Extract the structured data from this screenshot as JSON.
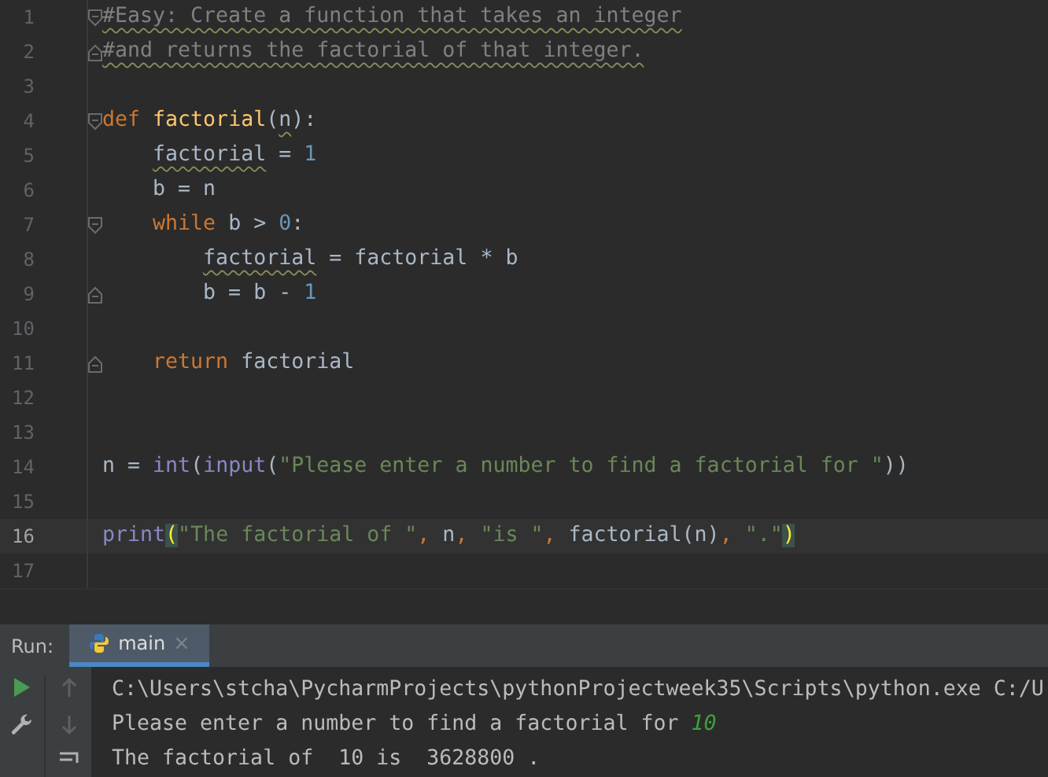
{
  "editor": {
    "lines": [
      {
        "number": "1",
        "current": false,
        "fold_start": true,
        "fold_end": false,
        "tokens": [
          {
            "text": "#Easy: Create a function that takes an integer",
            "kind": "comment",
            "squiggle": true
          }
        ]
      },
      {
        "number": "2",
        "current": false,
        "fold_start": false,
        "fold_end": true,
        "tokens": [
          {
            "text": "#and returns the factorial of that integer.",
            "kind": "comment",
            "squiggle": true
          }
        ]
      },
      {
        "number": "3",
        "current": false,
        "fold_start": false,
        "fold_end": false
      },
      {
        "number": "4",
        "current": false,
        "fold_start": true,
        "fold_end": false,
        "tokens": [
          {
            "text": "def ",
            "kind": "keyword",
            "squiggle": false
          },
          {
            "text": "factorial",
            "kind": "function",
            "squiggle": false
          },
          {
            "text": "(",
            "kind": "plain",
            "squiggle": false
          },
          {
            "text": "n",
            "kind": "plain",
            "squiggle": true
          },
          {
            "text": "):",
            "kind": "plain",
            "squiggle": false
          }
        ]
      },
      {
        "number": "5",
        "current": false,
        "fold_start": false,
        "fold_end": false,
        "tokens": [
          {
            "text": "    factorial",
            "kind": "plain",
            "squiggle": true
          },
          {
            "text": " = ",
            "kind": "plain",
            "squiggle": false
          },
          {
            "text": "1",
            "kind": "number",
            "squiggle": false
          }
        ]
      },
      {
        "number": "6",
        "current": false,
        "fold_start": false,
        "fold_end": false,
        "tokens": [
          {
            "text": "    b = n",
            "kind": "plain",
            "squiggle": false
          }
        ]
      },
      {
        "number": "7",
        "current": false,
        "fold_start": true,
        "fold_end": false,
        "tokens": [
          {
            "text": "    while",
            "kind": "keyword",
            "squiggle": false
          },
          {
            "text": " b > ",
            "kind": "plain",
            "squiggle": false
          },
          {
            "text": "0",
            "kind": "number",
            "squiggle": false
          },
          {
            "text": ":",
            "kind": "plain",
            "squiggle": false
          }
        ]
      },
      {
        "number": "8",
        "current": false,
        "fold_start": false,
        "fold_end": false,
        "tokens": [
          {
            "text": "        factorial",
            "kind": "plain",
            "squiggle": true
          },
          {
            "text": " = factorial * b",
            "kind": "plain",
            "squiggle": false
          }
        ]
      },
      {
        "number": "9",
        "current": false,
        "fold_start": false,
        "fold_end": true,
        "tokens": [
          {
            "text": "        b = b - ",
            "kind": "plain",
            "squiggle": false
          },
          {
            "text": "1",
            "kind": "number",
            "squiggle": false
          }
        ]
      },
      {
        "number": "10",
        "current": false,
        "fold_start": false,
        "fold_end": false
      },
      {
        "number": "11",
        "current": false,
        "fold_start": false,
        "fold_end": true,
        "tokens": [
          {
            "text": "    return",
            "kind": "keyword",
            "squiggle": false
          },
          {
            "text": " factorial",
            "kind": "plain",
            "squiggle": false
          }
        ]
      },
      {
        "number": "12",
        "current": false,
        "fold_start": false,
        "fold_end": false
      },
      {
        "number": "13",
        "current": false,
        "fold_start": false,
        "fold_end": false
      },
      {
        "number": "14",
        "current": false,
        "fold_start": false,
        "fold_end": false,
        "tokens": [
          {
            "text": "n = ",
            "kind": "plain",
            "squiggle": false
          },
          {
            "text": "int",
            "kind": "builtin",
            "squiggle": false
          },
          {
            "text": "(",
            "kind": "plain",
            "squiggle": false
          },
          {
            "text": "input",
            "kind": "builtin",
            "squiggle": false
          },
          {
            "text": "(",
            "kind": "plain",
            "squiggle": false
          },
          {
            "text": "\"Please enter a number to find a factorial for \"",
            "kind": "string",
            "squiggle": false
          },
          {
            "text": "))",
            "kind": "plain",
            "squiggle": false
          }
        ]
      },
      {
        "number": "15",
        "current": false,
        "fold_start": false,
        "fold_end": false
      },
      {
        "number": "16",
        "current": true,
        "fold_start": false,
        "fold_end": false,
        "tokens": [
          {
            "text": "print",
            "kind": "builtin",
            "squiggle": false
          },
          {
            "text": "(",
            "kind": "match",
            "squiggle": false
          },
          {
            "text": "\"The factorial of \"",
            "kind": "string",
            "squiggle": false
          },
          {
            "text": ", ",
            "kind": "comma",
            "squiggle": false
          },
          {
            "text": "n",
            "kind": "plain",
            "squiggle": false
          },
          {
            "text": ", ",
            "kind": "comma",
            "squiggle": false
          },
          {
            "text": "\"is \"",
            "kind": "string",
            "squiggle": false
          },
          {
            "text": ", ",
            "kind": "comma",
            "squiggle": false
          },
          {
            "text": "factorial(n)",
            "kind": "plain",
            "squiggle": false
          },
          {
            "text": ", ",
            "kind": "comma",
            "squiggle": false
          },
          {
            "text": "\".\"",
            "kind": "string",
            "squiggle": false
          },
          {
            "text": ")",
            "kind": "match",
            "squiggle": false
          }
        ]
      },
      {
        "number": "17",
        "current": false,
        "fold_start": false,
        "fold_end": false
      }
    ]
  },
  "run_panel": {
    "label": "Run:",
    "tabs": [
      {
        "label": "main",
        "selected": true,
        "close": "×"
      }
    ],
    "console": [
      {
        "tokens": [
          {
            "text": "C:\\Users\\stcha\\PycharmProjects\\pythonProjectweek35\\Scripts\\python.exe C:/U",
            "kind": "output"
          }
        ]
      },
      {
        "tokens": [
          {
            "text": "Please enter a number to find a factorial for ",
            "kind": "output"
          },
          {
            "text": "10",
            "kind": "input"
          }
        ]
      },
      {
        "tokens": [
          {
            "text": "The factorial of  10 is  3628800 .",
            "kind": "output"
          }
        ]
      }
    ]
  }
}
